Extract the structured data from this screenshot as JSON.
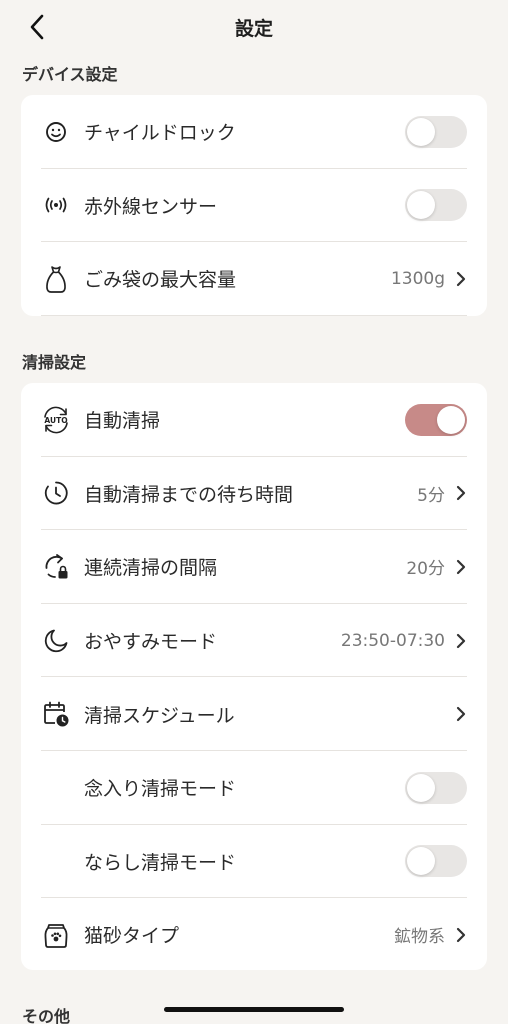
{
  "header": {
    "title": "設定"
  },
  "sections": {
    "device": {
      "title": "デバイス設定",
      "rows": {
        "child_lock": {
          "label": "チャイルドロック",
          "toggle_on": false
        },
        "ir_sensor": {
          "label": "赤外線センサー",
          "toggle_on": false
        },
        "bag_capacity": {
          "label": "ごみ袋の最大容量",
          "value": "1300g"
        }
      }
    },
    "cleaning": {
      "title": "清掃設定",
      "rows": {
        "auto_clean": {
          "label": "自動清掃",
          "toggle_on": true
        },
        "wait_time": {
          "label": "自動清掃までの待ち時間",
          "value": "5分"
        },
        "interval": {
          "label": "連続清掃の間隔",
          "value": "20分"
        },
        "sleep_mode": {
          "label": "おやすみモード",
          "value": "23:50-07:30"
        },
        "schedule": {
          "label": "清掃スケジュール"
        },
        "deep_clean": {
          "label": "念入り清掃モード",
          "toggle_on": false
        },
        "level_clean": {
          "label": "ならし清掃モード",
          "toggle_on": false
        },
        "litter_type": {
          "label": "猫砂タイプ",
          "value": "鉱物系"
        }
      }
    },
    "other": {
      "title": "その他"
    }
  },
  "colors": {
    "toggle_on": "#c78a88",
    "toggle_off": "#e8e6e4",
    "background": "#f6f4f1"
  },
  "icons": {
    "back": "chevron-left-icon",
    "child_lock": "smiley-lock-icon",
    "ir_sensor": "signal-waves-icon",
    "bag": "trash-bag-icon",
    "auto": "auto-refresh-icon",
    "wait": "clock-icon",
    "interval": "refresh-lock-icon",
    "sleep": "moon-icon",
    "schedule": "calendar-clock-icon",
    "litter": "litter-bag-icon"
  }
}
